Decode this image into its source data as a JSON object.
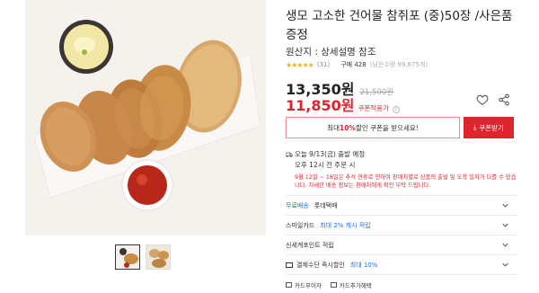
{
  "product": {
    "title": "생모 고소한 건어물 참쥐포 (중)50장 /사은품 증정",
    "origin": "원산지 : 상세설명 참조",
    "rating_stars": "★★★★★",
    "review_count": "(31)",
    "purchase": "구매 428",
    "stock": "(남은수량 99,675개)",
    "price": "13,350원",
    "original_price": "21,500원",
    "coupon_price": "11,850원",
    "coupon_price_label": "쿠폰적용가"
  },
  "coupon": {
    "box_prefix": "최대 ",
    "box_highlight": "10%",
    "box_suffix": " 할인 쿠폰을 받으세요!",
    "button_label": "쿠폰받기"
  },
  "delivery": {
    "line1": "오늘 9/13(금) 출발 예정",
    "line2": "오후 12시 전 주문 시",
    "notice": "9월 12일 ~ 18일은 추석 연휴로 인하여 판매처별로 상품의 출발 및 도착 일자가 다를 수 있습니다. 자세한 배송 정보는 판매처에게 확인 부탁 드립니다."
  },
  "rows": [
    {
      "label": "무료배송",
      "extra": "롯데택배",
      "label_blue": true
    },
    {
      "label": "스마일카드",
      "extra": "최대 2% 캐시 적립"
    },
    {
      "label": "신세계포인트 적립",
      "extra": ""
    },
    {
      "label": "결제수단 즉시할인",
      "extra": "최대 10%",
      "card": true
    }
  ],
  "pay_buttons": [
    {
      "label": "카드무이자"
    },
    {
      "label": "카드추가혜택"
    }
  ],
  "colors": {
    "accent_red": "#e0242d",
    "accent_blue": "#1d6fe0",
    "star": "#f2b01e"
  }
}
